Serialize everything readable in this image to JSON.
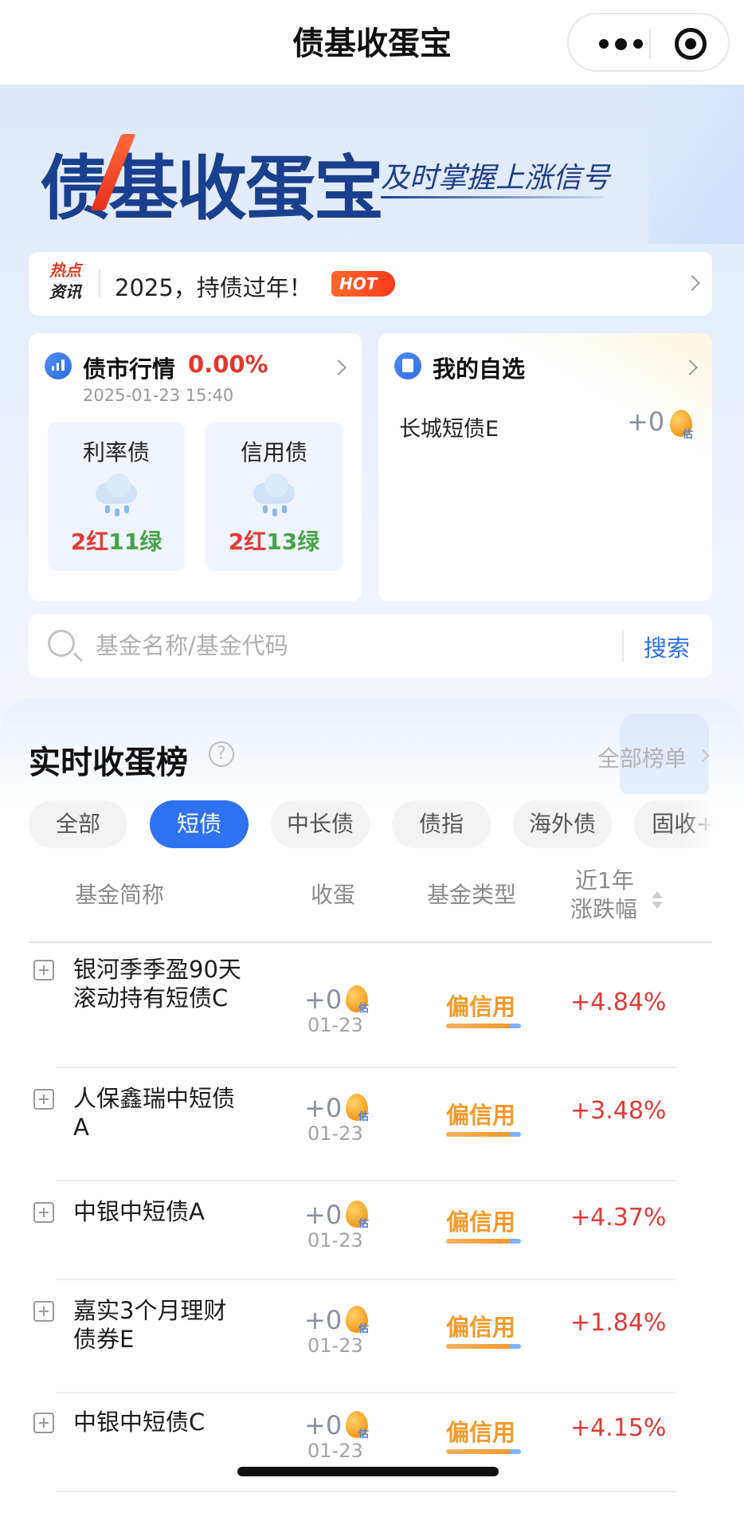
{
  "navbar": {
    "title": "债基收蛋宝"
  },
  "hero": {
    "brand_logo": "债基收蛋宝",
    "slogan": "及时掌握上涨信号",
    "news": {
      "tag_line1": "热点",
      "tag_line2": "资讯",
      "text": "2025，持债过年！",
      "badge": "HOT"
    }
  },
  "market": {
    "title": "债市行情",
    "change": "0.00%",
    "time": "2025-01-23 15:40",
    "cards": [
      {
        "name": "利率债",
        "icon": "rain-cloud-icon",
        "red": "2红",
        "green": "11绿"
      },
      {
        "name": "信用债",
        "icon": "rain-cloud-icon",
        "red": "2红",
        "green": "13绿"
      }
    ]
  },
  "watchlist": {
    "title": "我的自选",
    "items": [
      {
        "name": "长城短债E",
        "value": "+0",
        "mark": "估"
      }
    ]
  },
  "search": {
    "placeholder": "基金名称/基金代码",
    "button": "搜索"
  },
  "ranking": {
    "title": "实时收蛋榜",
    "help": "?",
    "all_link": "全部榜单",
    "tabs": [
      "全部",
      "短债",
      "中长债",
      "债指",
      "海外债",
      "固收+"
    ],
    "active_tab": "短债",
    "columns": {
      "name": "基金简称",
      "earn": "收蛋",
      "type": "基金类型",
      "change_line1": "近1年",
      "change_line2": "涨跌幅"
    },
    "rows": [
      {
        "name": "银河季季盈90天滚动持有短债C",
        "earn": "+0",
        "mark": "估",
        "date": "01-23",
        "type": "偏信用",
        "change": "+4.84%"
      },
      {
        "name": "人保鑫瑞中短债A",
        "earn": "+0",
        "mark": "估",
        "date": "01-23",
        "type": "偏信用",
        "change": "+3.48%"
      },
      {
        "name": "中银中短债A",
        "earn": "+0",
        "mark": "估",
        "date": "01-23",
        "type": "偏信用",
        "change": "+4.37%"
      },
      {
        "name": "嘉实3个月理财债券E",
        "earn": "+0",
        "mark": "估",
        "date": "01-23",
        "type": "偏信用",
        "change": "+1.84%"
      },
      {
        "name": "中银中短债C",
        "earn": "+0",
        "mark": "估",
        "date": "01-23",
        "type": "偏信用",
        "change": "+4.15%"
      }
    ]
  },
  "colors": {
    "accent": "#2f72f0",
    "up": "#e23b36",
    "down": "#48a34b",
    "type": "#f39a2c",
    "brand": "#1a3f8c"
  }
}
